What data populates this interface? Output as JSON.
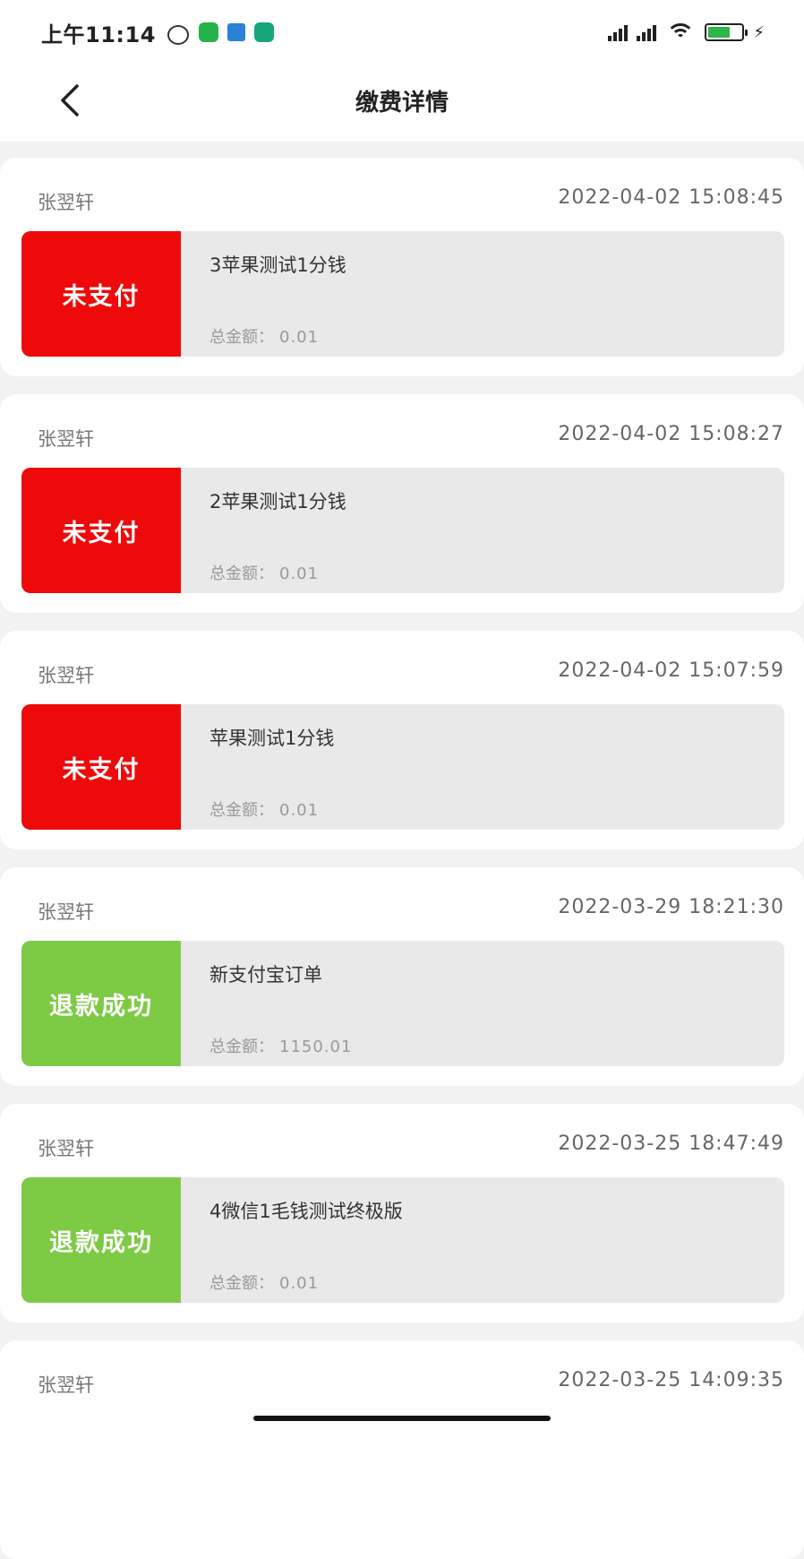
{
  "status_bar": {
    "time": "上午11:14",
    "colors": {
      "battery": "#30b54a"
    }
  },
  "header": {
    "title": "缴费详情",
    "back_icon": "chevron-left-icon"
  },
  "orders": [
    {
      "name": "张翌轩",
      "time": "2022-04-02 15:08:45",
      "status": "未支付",
      "status_color": "#ee0a0a",
      "title": "3苹果测试1分钱",
      "amount_label": "总金额：",
      "amount": "0.01"
    },
    {
      "name": "张翌轩",
      "time": "2022-04-02 15:08:27",
      "status": "未支付",
      "status_color": "#ee0a0a",
      "title": "2苹果测试1分钱",
      "amount_label": "总金额：",
      "amount": "0.01"
    },
    {
      "name": "张翌轩",
      "time": "2022-04-02 15:07:59",
      "status": "未支付",
      "status_color": "#ee0a0a",
      "title": "苹果测试1分钱",
      "amount_label": "总金额：",
      "amount": "0.01"
    },
    {
      "name": "张翌轩",
      "time": "2022-03-29 18:21:30",
      "status": "退款成功",
      "status_color": "#7dcb45",
      "title": "新支付宝订单",
      "amount_label": "总金额：",
      "amount": "1150.01"
    },
    {
      "name": "张翌轩",
      "time": "2022-03-25 18:47:49",
      "status": "退款成功",
      "status_color": "#7dcb45",
      "title": "4微信1毛钱测试终极版",
      "amount_label": "总金额：",
      "amount": "0.01"
    },
    {
      "name": "张翌轩",
      "time": "2022-03-25 14:09:35"
    }
  ]
}
